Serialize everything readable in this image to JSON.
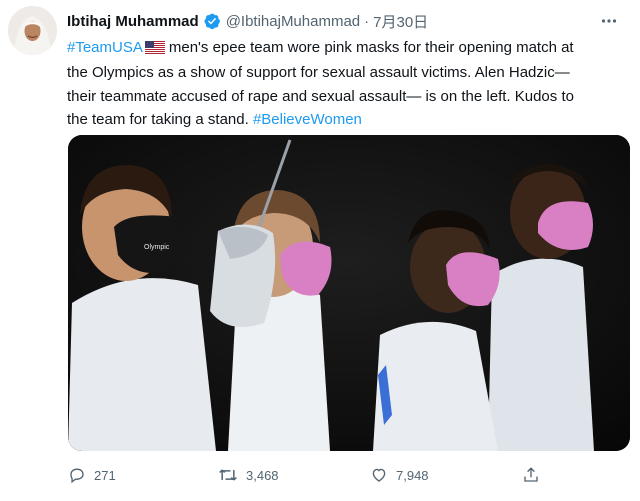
{
  "author": {
    "name": "Ibtihaj Muhammad",
    "handle": "@IbtihajMuhammad",
    "separator": "·",
    "date": "7月30日"
  },
  "tweet": {
    "hashtag_1": "#TeamUSA",
    "flag_icon": "us-flag-icon",
    "line_1_rest": "men's epee team wore pink masks for their opening match at",
    "line_2": "the Olympics as a show of support for sexual assault victims. Alen Hadzic—",
    "line_3": "their teammate accused of rape and sexual assault— is on the left. Kudos to",
    "line_4_pre": "the team for taking a stand.",
    "hashtag_2": "#BelieveWomen"
  },
  "media": {
    "mask_logo_text": "Olympic"
  },
  "actions": {
    "reply_count": "271",
    "retweet_count": "3,468",
    "like_count": "7,948"
  },
  "colors": {
    "link": "#1d9bf0",
    "secondary_text": "#536471",
    "mask_pink": "#d97fc4"
  }
}
